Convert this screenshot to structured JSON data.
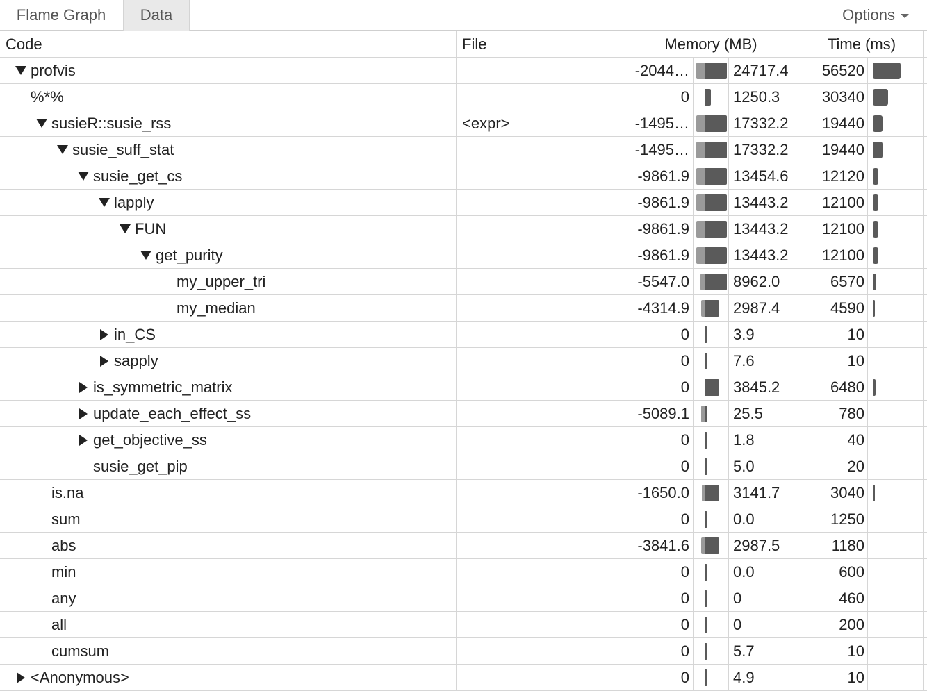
{
  "tabs": [
    {
      "label": "Flame Graph",
      "active": false
    },
    {
      "label": "Data",
      "active": true
    }
  ],
  "options_label": "Options",
  "headers": {
    "code": "Code",
    "file": "File",
    "memory": "Memory (MB)",
    "time": "Time (ms)"
  },
  "colors": {
    "bar_dark": "#5a5a5a",
    "bar_light": "#9a9a9a",
    "grid": "#d6d6d6"
  },
  "rows": [
    {
      "code": "profvis",
      "depth": 0,
      "toggle": "expanded",
      "file": "",
      "mem_neg": "-2044…",
      "mem_pos": "24717.4",
      "time": "56520",
      "mem_neg_frac": 0.25,
      "mem_pos_frac": 0.62,
      "time_frac": 1.0
    },
    {
      "code": "%*%",
      "depth": 0,
      "toggle": "none",
      "file": "",
      "mem_neg": "0",
      "mem_pos": "1250.3",
      "time": "30340",
      "mem_neg_frac": 0,
      "mem_pos_frac": 0.15,
      "time_frac": 0.54
    },
    {
      "code": "susieR::susie_rss",
      "depth": 1,
      "toggle": "expanded",
      "file": "<expr>",
      "mem_neg": "-1495…",
      "mem_pos": "17332.2",
      "time": "19440",
      "mem_neg_frac": 0.25,
      "mem_pos_frac": 0.62,
      "time_frac": 0.34
    },
    {
      "code": "susie_suff_stat",
      "depth": 2,
      "toggle": "expanded",
      "file": "",
      "mem_neg": "-1495…",
      "mem_pos": "17332.2",
      "time": "19440",
      "mem_neg_frac": 0.25,
      "mem_pos_frac": 0.62,
      "time_frac": 0.34
    },
    {
      "code": "susie_get_cs",
      "depth": 3,
      "toggle": "expanded",
      "file": "",
      "mem_neg": "-9861.9",
      "mem_pos": "13454.6",
      "time": "12120",
      "mem_neg_frac": 0.25,
      "mem_pos_frac": 0.62,
      "time_frac": 0.21
    },
    {
      "code": "lapply",
      "depth": 4,
      "toggle": "expanded",
      "file": "",
      "mem_neg": "-9861.9",
      "mem_pos": "13443.2",
      "time": "12100",
      "mem_neg_frac": 0.25,
      "mem_pos_frac": 0.62,
      "time_frac": 0.21
    },
    {
      "code": "FUN",
      "depth": 5,
      "toggle": "expanded",
      "file": "",
      "mem_neg": "-9861.9",
      "mem_pos": "13443.2",
      "time": "12100",
      "mem_neg_frac": 0.25,
      "mem_pos_frac": 0.62,
      "time_frac": 0.21
    },
    {
      "code": "get_purity",
      "depth": 6,
      "toggle": "expanded",
      "file": "",
      "mem_neg": "-9861.9",
      "mem_pos": "13443.2",
      "time": "12100",
      "mem_neg_frac": 0.25,
      "mem_pos_frac": 0.62,
      "time_frac": 0.21
    },
    {
      "code": "my_upper_tri",
      "depth": 7,
      "toggle": "none",
      "file": "",
      "mem_neg": "-5547.0",
      "mem_pos": "8962.0",
      "time": "6570",
      "mem_neg_frac": 0.14,
      "mem_pos_frac": 0.62,
      "time_frac": 0.12
    },
    {
      "code": "my_median",
      "depth": 7,
      "toggle": "none",
      "file": "",
      "mem_neg": "-4314.9",
      "mem_pos": "2987.4",
      "time": "4590",
      "mem_neg_frac": 0.12,
      "mem_pos_frac": 0.4,
      "time_frac": 0.08
    },
    {
      "code": "in_CS",
      "depth": 4,
      "toggle": "collapsed",
      "file": "",
      "mem_neg": "0",
      "mem_pos": "3.9",
      "time": "10",
      "mem_neg_frac": 0,
      "mem_pos_frac": 0.05,
      "time_frac": 0
    },
    {
      "code": "sapply",
      "depth": 4,
      "toggle": "collapsed",
      "file": "",
      "mem_neg": "0",
      "mem_pos": "7.6",
      "time": "10",
      "mem_neg_frac": 0,
      "mem_pos_frac": 0.05,
      "time_frac": 0
    },
    {
      "code": "is_symmetric_matrix",
      "depth": 3,
      "toggle": "collapsed",
      "file": "",
      "mem_neg": "0",
      "mem_pos": "3845.2",
      "time": "6480",
      "mem_neg_frac": 0,
      "mem_pos_frac": 0.4,
      "time_frac": 0.11
    },
    {
      "code": "update_each_effect_ss",
      "depth": 3,
      "toggle": "collapsed",
      "file": "",
      "mem_neg": "-5089.1",
      "mem_pos": "25.5",
      "time": "780",
      "mem_neg_frac": 0.12,
      "mem_pos_frac": 0.05,
      "time_frac": 0
    },
    {
      "code": "get_objective_ss",
      "depth": 3,
      "toggle": "collapsed",
      "file": "",
      "mem_neg": "0",
      "mem_pos": "1.8",
      "time": "40",
      "mem_neg_frac": 0,
      "mem_pos_frac": 0.05,
      "time_frac": 0
    },
    {
      "code": "susie_get_pip",
      "depth": 3,
      "toggle": "none",
      "file": "",
      "mem_neg": "0",
      "mem_pos": "5.0",
      "time": "20",
      "mem_neg_frac": 0,
      "mem_pos_frac": 0.05,
      "time_frac": 0
    },
    {
      "code": "is.na",
      "depth": 1,
      "toggle": "none",
      "file": "",
      "mem_neg": "-1650.0",
      "mem_pos": "3141.7",
      "time": "3040",
      "mem_neg_frac": 0.1,
      "mem_pos_frac": 0.4,
      "time_frac": 0.02
    },
    {
      "code": "sum",
      "depth": 1,
      "toggle": "none",
      "file": "",
      "mem_neg": "0",
      "mem_pos": "0.0",
      "time": "1250",
      "mem_neg_frac": 0,
      "mem_pos_frac": 0.05,
      "time_frac": 0
    },
    {
      "code": "abs",
      "depth": 1,
      "toggle": "none",
      "file": "",
      "mem_neg": "-3841.6",
      "mem_pos": "2987.5",
      "time": "1180",
      "mem_neg_frac": 0.12,
      "mem_pos_frac": 0.4,
      "time_frac": 0
    },
    {
      "code": "min",
      "depth": 1,
      "toggle": "none",
      "file": "",
      "mem_neg": "0",
      "mem_pos": "0.0",
      "time": "600",
      "mem_neg_frac": 0,
      "mem_pos_frac": 0.05,
      "time_frac": 0
    },
    {
      "code": "any",
      "depth": 1,
      "toggle": "none",
      "file": "",
      "mem_neg": "0",
      "mem_pos": "0",
      "time": "460",
      "mem_neg_frac": 0,
      "mem_pos_frac": 0.05,
      "time_frac": 0
    },
    {
      "code": "all",
      "depth": 1,
      "toggle": "none",
      "file": "",
      "mem_neg": "0",
      "mem_pos": "0",
      "time": "200",
      "mem_neg_frac": 0,
      "mem_pos_frac": 0.05,
      "time_frac": 0
    },
    {
      "code": "cumsum",
      "depth": 1,
      "toggle": "none",
      "file": "",
      "mem_neg": "0",
      "mem_pos": "5.7",
      "time": "10",
      "mem_neg_frac": 0,
      "mem_pos_frac": 0.05,
      "time_frac": 0
    },
    {
      "code": "<Anonymous>",
      "depth": 0,
      "toggle": "collapsed",
      "file": "",
      "mem_neg": "0",
      "mem_pos": "4.9",
      "time": "10",
      "mem_neg_frac": 0,
      "mem_pos_frac": 0.05,
      "time_frac": 0
    }
  ]
}
